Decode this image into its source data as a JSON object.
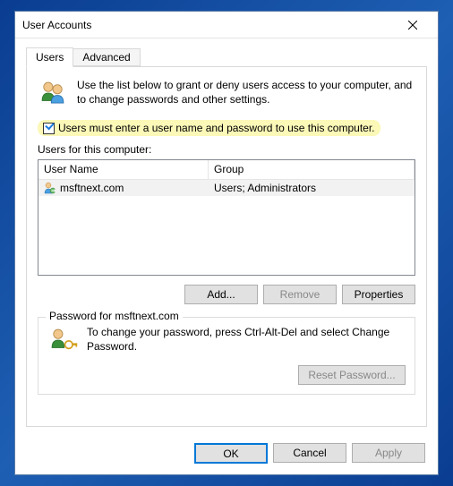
{
  "window": {
    "title": "User Accounts"
  },
  "tabs": {
    "users": "Users",
    "advanced": "Advanced"
  },
  "info_text": "Use the list below to grant or deny users access to your computer, and to change passwords and other settings.",
  "checkbox_label": "Users must enter a user name and password to use this computer.",
  "list": {
    "label": "Users for this computer:",
    "col_user": "User Name",
    "col_group": "Group",
    "rows": [
      {
        "user": "msftnext.com",
        "group": "Users; Administrators"
      }
    ]
  },
  "buttons": {
    "add": "Add...",
    "remove": "Remove",
    "properties": "Properties",
    "reset": "Reset Password...",
    "ok": "OK",
    "cancel": "Cancel",
    "apply": "Apply"
  },
  "password_box": {
    "label": "Password for msftnext.com",
    "text": "To change your password, press Ctrl-Alt-Del and select Change Password."
  }
}
